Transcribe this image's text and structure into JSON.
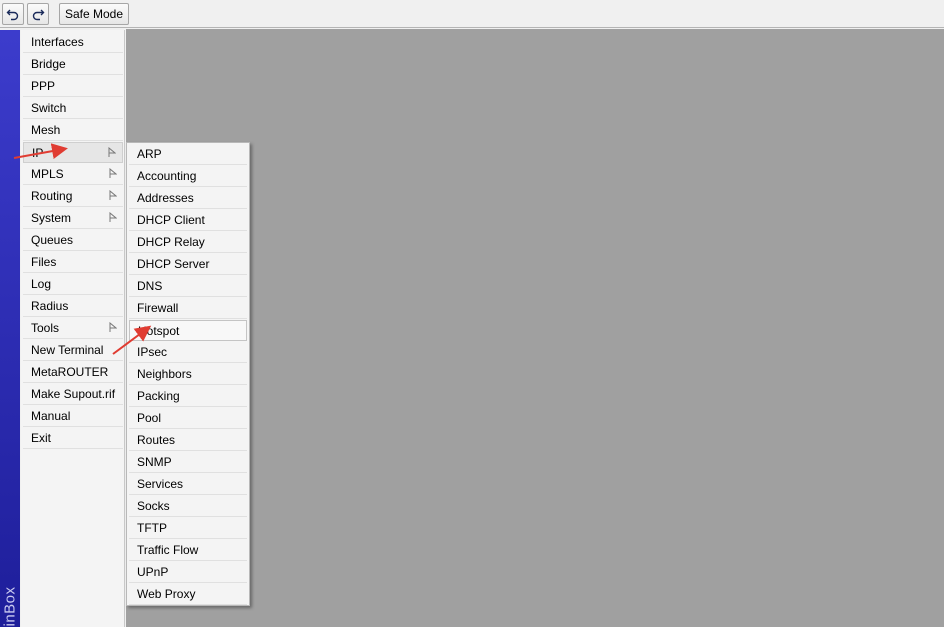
{
  "toolbar": {
    "undo_icon": "undo-icon",
    "redo_icon": "redo-icon",
    "safe_mode_label": "Safe Mode"
  },
  "brand": {
    "text": "inBox"
  },
  "main_menu": {
    "items": [
      {
        "label": "Interfaces",
        "submenu": false
      },
      {
        "label": "Bridge",
        "submenu": false
      },
      {
        "label": "PPP",
        "submenu": false
      },
      {
        "label": "Switch",
        "submenu": false
      },
      {
        "label": "Mesh",
        "submenu": false
      },
      {
        "label": "IP",
        "submenu": true,
        "active": true
      },
      {
        "label": "MPLS",
        "submenu": true
      },
      {
        "label": "Routing",
        "submenu": true
      },
      {
        "label": "System",
        "submenu": true
      },
      {
        "label": "Queues",
        "submenu": false
      },
      {
        "label": "Files",
        "submenu": false
      },
      {
        "label": "Log",
        "submenu": false
      },
      {
        "label": "Radius",
        "submenu": false
      },
      {
        "label": "Tools",
        "submenu": true
      },
      {
        "label": "New Terminal",
        "submenu": false
      },
      {
        "label": "MetaROUTER",
        "submenu": false
      },
      {
        "label": "Make Supout.rif",
        "submenu": false
      },
      {
        "label": "Manual",
        "submenu": false
      },
      {
        "label": "Exit",
        "submenu": false
      }
    ]
  },
  "ip_submenu": {
    "items": [
      {
        "label": "ARP"
      },
      {
        "label": "Accounting"
      },
      {
        "label": "Addresses"
      },
      {
        "label": "DHCP Client"
      },
      {
        "label": "DHCP Relay"
      },
      {
        "label": "DHCP Server"
      },
      {
        "label": "DNS"
      },
      {
        "label": "Firewall"
      },
      {
        "label": "Hotspot",
        "highlight": true
      },
      {
        "label": "IPsec"
      },
      {
        "label": "Neighbors"
      },
      {
        "label": "Packing"
      },
      {
        "label": "Pool"
      },
      {
        "label": "Routes"
      },
      {
        "label": "SNMP"
      },
      {
        "label": "Services"
      },
      {
        "label": "Socks"
      },
      {
        "label": "TFTP"
      },
      {
        "label": "Traffic Flow"
      },
      {
        "label": "UPnP"
      },
      {
        "label": "Web Proxy"
      }
    ]
  },
  "colors": {
    "workspace": "#a0a0a0",
    "brand_strip": "#2a2ab0",
    "annotation_arrow": "#e03c32"
  }
}
